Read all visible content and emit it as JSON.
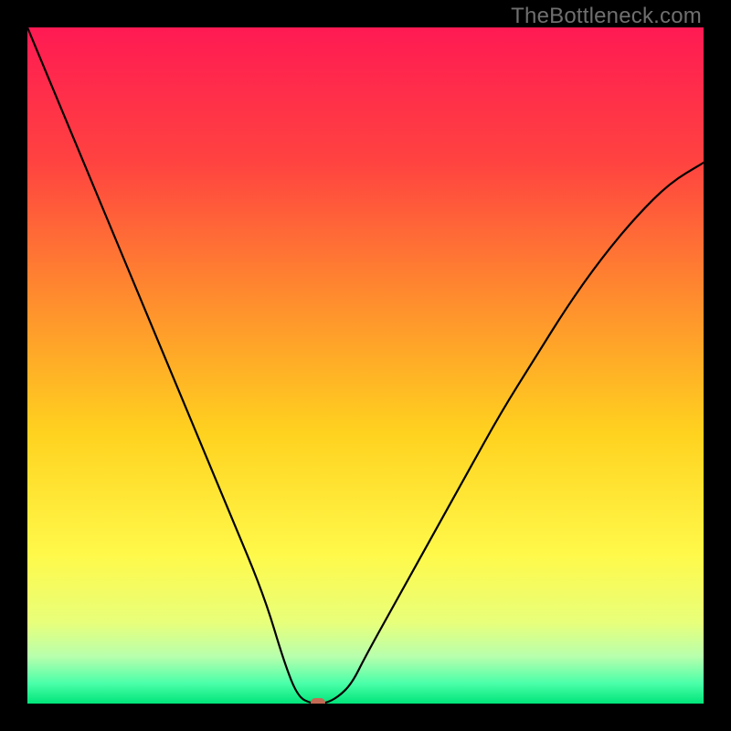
{
  "watermark": "TheBottleneck.com",
  "chart_data": {
    "type": "line",
    "title": "",
    "xlabel": "",
    "ylabel": "",
    "xlim": [
      0,
      100
    ],
    "ylim": [
      0,
      100
    ],
    "grid": false,
    "legend": false,
    "series": [
      {
        "name": "bottleneck-curve",
        "x": [
          0,
          5,
          10,
          15,
          20,
          25,
          30,
          35,
          38,
          40,
          42,
          44,
          46,
          48,
          50,
          55,
          60,
          65,
          70,
          75,
          80,
          85,
          90,
          95,
          100
        ],
        "values": [
          100,
          88,
          76,
          64,
          52,
          40,
          28,
          16,
          6,
          1,
          0,
          0,
          1,
          3,
          7,
          16,
          25,
          34,
          43,
          51,
          59,
          66,
          72,
          77,
          80
        ]
      }
    ],
    "marker": {
      "x": 43,
      "y": 0,
      "color": "#c36a55"
    },
    "background_gradient": {
      "stops": [
        {
          "offset": 0,
          "color": "#ff1a53"
        },
        {
          "offset": 20,
          "color": "#ff4340"
        },
        {
          "offset": 40,
          "color": "#ff8c2e"
        },
        {
          "offset": 60,
          "color": "#ffd21f"
        },
        {
          "offset": 78,
          "color": "#fff94a"
        },
        {
          "offset": 88,
          "color": "#e8ff7a"
        },
        {
          "offset": 93,
          "color": "#b8ffad"
        },
        {
          "offset": 97,
          "color": "#4bffa9"
        },
        {
          "offset": 100,
          "color": "#00e57a"
        }
      ]
    }
  }
}
